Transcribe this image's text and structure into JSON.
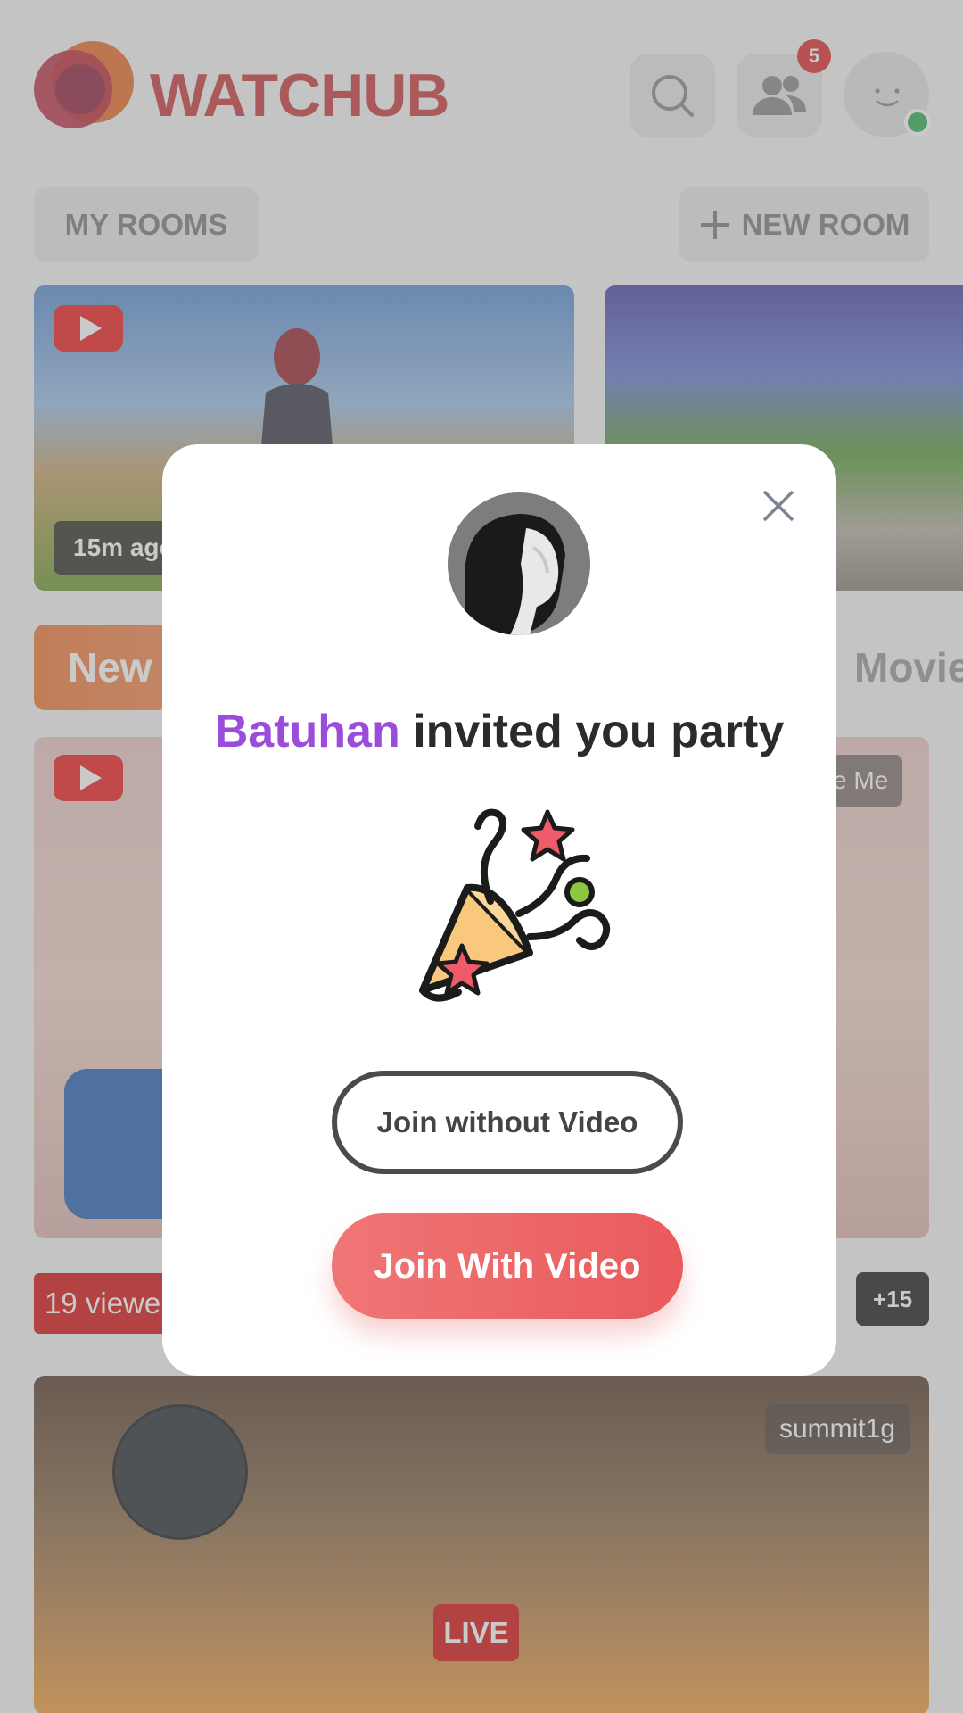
{
  "app": {
    "brand": "WATCHUB",
    "notifications_count": "5",
    "colors": {
      "brand": "#c93f3f",
      "accent_purple": "#9a4ddb",
      "primary_button": "#ec6264",
      "online": "#33b05b",
      "badge": "#e02f2f",
      "live": "#d81818"
    }
  },
  "header": {
    "search_icon": "search-icon",
    "friends_icon": "people-icon",
    "avatar_icon": "smiley-avatar-icon"
  },
  "toolbar": {
    "my_rooms_label": "MY ROOMS",
    "new_room_label": "NEW ROOM",
    "new_room_icon": "plus-icon"
  },
  "rooms": {
    "first_card_time": "15m ago",
    "categories": [
      "New",
      "Movie"
    ],
    "second_card_tag": "e Me",
    "viewers_label": "19 viewe",
    "extra_count": "+15",
    "live_label": "LIVE",
    "streamer_name": "summit1g"
  },
  "modal": {
    "inviter_name": "Batuhan",
    "invite_text": "invited you party",
    "illustration": "party-popper-icon",
    "join_without_video_label": "Join without Video",
    "join_with_video_label": "Join With Video",
    "close_icon": "close-icon"
  }
}
